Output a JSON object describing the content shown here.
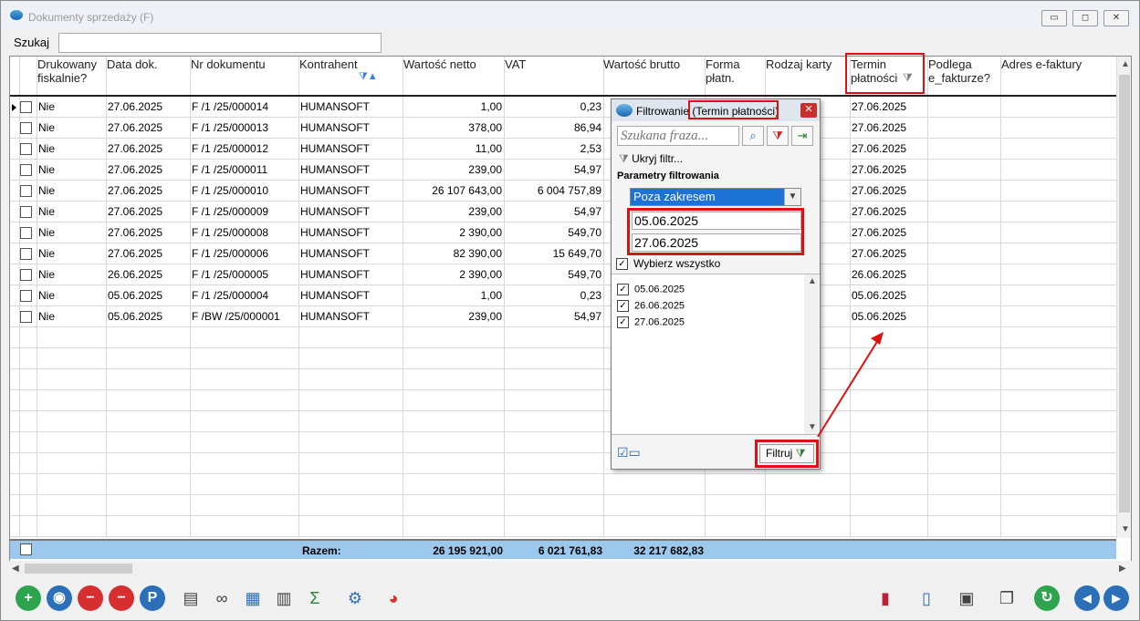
{
  "window": {
    "title": "Dokumenty sprzedaży (F)"
  },
  "search": {
    "label": "Szukaj",
    "value": "",
    "placeholder": ""
  },
  "columns": [
    {
      "line1": "Drukowany",
      "line2": "fiskalnie?"
    },
    {
      "line1": "Data dok.",
      "line2": ""
    },
    {
      "line1": "Nr dokumentu",
      "line2": ""
    },
    {
      "line1": "Kontrahent",
      "line2": ""
    },
    {
      "line1": "Wartość netto",
      "line2": ""
    },
    {
      "line1": "VAT",
      "line2": ""
    },
    {
      "line1": "Wartość brutto",
      "line2": ""
    },
    {
      "line1": "Forma",
      "line2": "płatn."
    },
    {
      "line1": "Rodzaj karty",
      "line2": ""
    },
    {
      "line1": "Termin",
      "line2": "płatności"
    },
    {
      "line1": "Podlega",
      "line2": "e_fakturze?"
    },
    {
      "line1": "Adres e-faktury",
      "line2": ""
    }
  ],
  "rows": [
    {
      "druk": "Nie",
      "data": "27.06.2025",
      "nr": "F /1  /25/000014",
      "kontr": "HUMANSOFT",
      "netto": "1,00",
      "vat": "0,23",
      "termin": "27.06.2025"
    },
    {
      "druk": "Nie",
      "data": "27.06.2025",
      "nr": "F /1  /25/000013",
      "kontr": "HUMANSOFT",
      "netto": "378,00",
      "vat": "86,94",
      "termin": "27.06.2025"
    },
    {
      "druk": "Nie",
      "data": "27.06.2025",
      "nr": "F /1  /25/000012",
      "kontr": "HUMANSOFT",
      "netto": "11,00",
      "vat": "2,53",
      "termin": "27.06.2025"
    },
    {
      "druk": "Nie",
      "data": "27.06.2025",
      "nr": "F /1  /25/000011",
      "kontr": "HUMANSOFT",
      "netto": "239,00",
      "vat": "54,97",
      "termin": "27.06.2025"
    },
    {
      "druk": "Nie",
      "data": "27.06.2025",
      "nr": "F /1  /25/000010",
      "kontr": "HUMANSOFT",
      "netto": "26 107 643,00",
      "vat": "6 004 757,89",
      "termin": "27.06.2025"
    },
    {
      "druk": "Nie",
      "data": "27.06.2025",
      "nr": "F /1  /25/000009",
      "kontr": "HUMANSOFT",
      "netto": "239,00",
      "vat": "54,97",
      "termin": "27.06.2025"
    },
    {
      "druk": "Nie",
      "data": "27.06.2025",
      "nr": "F /1  /25/000008",
      "kontr": "HUMANSOFT",
      "netto": "2 390,00",
      "vat": "549,70",
      "termin": "27.06.2025"
    },
    {
      "druk": "Nie",
      "data": "27.06.2025",
      "nr": "F /1  /25/000006",
      "kontr": "HUMANSOFT",
      "netto": "82 390,00",
      "vat": "15 649,70",
      "termin": "27.06.2025"
    },
    {
      "druk": "Nie",
      "data": "26.06.2025",
      "nr": "F /1  /25/000005",
      "kontr": "HUMANSOFT",
      "netto": "2 390,00",
      "vat": "549,70",
      "termin": "26.06.2025"
    },
    {
      "druk": "Nie",
      "data": "05.06.2025",
      "nr": "F /1  /25/000004",
      "kontr": "HUMANSOFT",
      "netto": "1,00",
      "vat": "0,23",
      "termin": "05.06.2025"
    },
    {
      "druk": "Nie",
      "data": "05.06.2025",
      "nr": "F /BW /25/000001",
      "kontr": "HUMANSOFT",
      "netto": "239,00",
      "vat": "54,97",
      "termin": "05.06.2025"
    }
  ],
  "footer": {
    "label": "Razem:",
    "netto": "26 195 921,00",
    "vat": "6 021 761,83",
    "brutto": "32 217 682,83"
  },
  "popup": {
    "title": "Filtrowanie",
    "title_field": "(Termin płatności)",
    "search_placeholder": "Szukana fraza...",
    "hide_filter": "Ukryj filtr...",
    "params_label": "Parametry filtrowania",
    "range_mode": "Poza zakresem",
    "date_from": "05.06.2025",
    "date_to": "27.06.2025",
    "select_all": "Wybierz wszystko",
    "values": [
      "05.06.2025",
      "26.06.2025",
      "27.06.2025"
    ],
    "filter_button": "Filtruj"
  },
  "icons": {
    "toolbar_left": [
      "add-icon",
      "preview-icon",
      "delete-icon",
      "cancel-icon",
      "parking-icon",
      "print-icon",
      "binoculars-icon",
      "calendar-icon",
      "shredder-icon",
      "sum-icon",
      "settings-gears-icon",
      "window-chart-icon"
    ],
    "toolbar_right": [
      "report-chart-icon",
      "document-icon",
      "save-icon",
      "windows-icon",
      "refresh-icon",
      "prev-icon",
      "next-icon"
    ]
  },
  "colors": {
    "footer_bg": "#9cc8ee",
    "highlight": "#e01010",
    "selection": "#1d72d6"
  }
}
